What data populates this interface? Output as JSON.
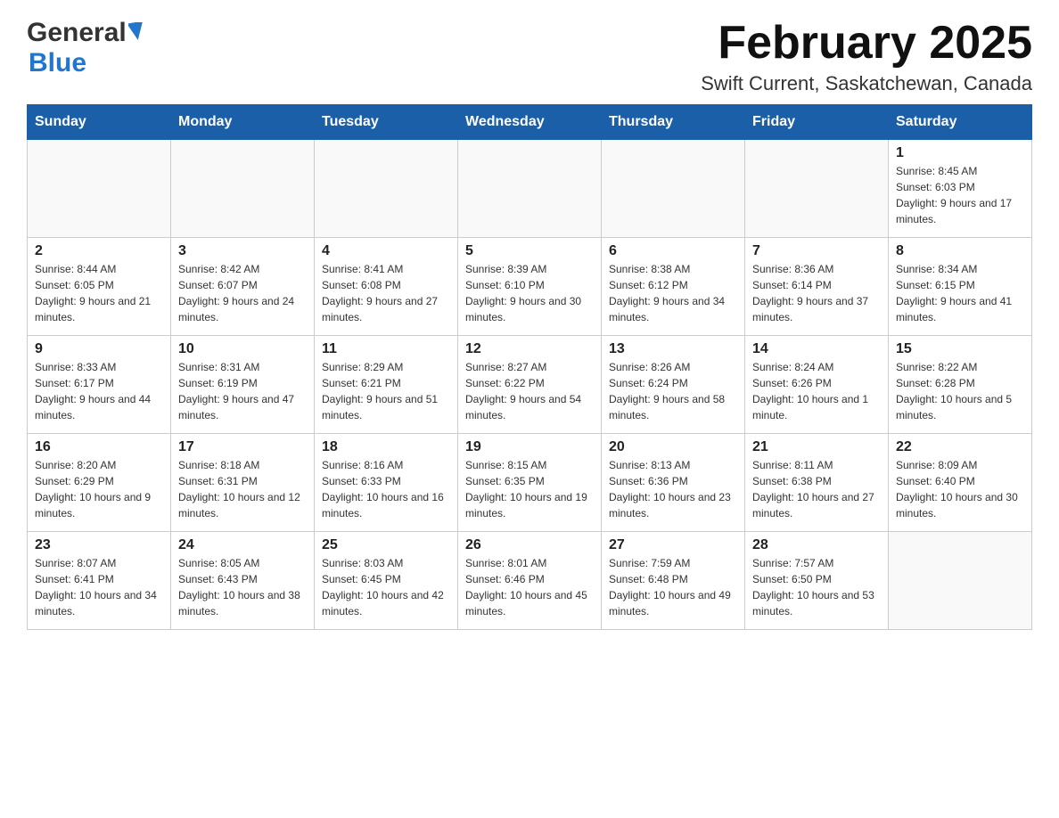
{
  "header": {
    "logo_general": "General",
    "logo_blue": "Blue",
    "title": "February 2025",
    "subtitle": "Swift Current, Saskatchewan, Canada"
  },
  "weekdays": [
    "Sunday",
    "Monday",
    "Tuesday",
    "Wednesday",
    "Thursday",
    "Friday",
    "Saturday"
  ],
  "weeks": [
    [
      {
        "day": "",
        "info": ""
      },
      {
        "day": "",
        "info": ""
      },
      {
        "day": "",
        "info": ""
      },
      {
        "day": "",
        "info": ""
      },
      {
        "day": "",
        "info": ""
      },
      {
        "day": "",
        "info": ""
      },
      {
        "day": "1",
        "info": "Sunrise: 8:45 AM\nSunset: 6:03 PM\nDaylight: 9 hours and 17 minutes."
      }
    ],
    [
      {
        "day": "2",
        "info": "Sunrise: 8:44 AM\nSunset: 6:05 PM\nDaylight: 9 hours and 21 minutes."
      },
      {
        "day": "3",
        "info": "Sunrise: 8:42 AM\nSunset: 6:07 PM\nDaylight: 9 hours and 24 minutes."
      },
      {
        "day": "4",
        "info": "Sunrise: 8:41 AM\nSunset: 6:08 PM\nDaylight: 9 hours and 27 minutes."
      },
      {
        "day": "5",
        "info": "Sunrise: 8:39 AM\nSunset: 6:10 PM\nDaylight: 9 hours and 30 minutes."
      },
      {
        "day": "6",
        "info": "Sunrise: 8:38 AM\nSunset: 6:12 PM\nDaylight: 9 hours and 34 minutes."
      },
      {
        "day": "7",
        "info": "Sunrise: 8:36 AM\nSunset: 6:14 PM\nDaylight: 9 hours and 37 minutes."
      },
      {
        "day": "8",
        "info": "Sunrise: 8:34 AM\nSunset: 6:15 PM\nDaylight: 9 hours and 41 minutes."
      }
    ],
    [
      {
        "day": "9",
        "info": "Sunrise: 8:33 AM\nSunset: 6:17 PM\nDaylight: 9 hours and 44 minutes."
      },
      {
        "day": "10",
        "info": "Sunrise: 8:31 AM\nSunset: 6:19 PM\nDaylight: 9 hours and 47 minutes."
      },
      {
        "day": "11",
        "info": "Sunrise: 8:29 AM\nSunset: 6:21 PM\nDaylight: 9 hours and 51 minutes."
      },
      {
        "day": "12",
        "info": "Sunrise: 8:27 AM\nSunset: 6:22 PM\nDaylight: 9 hours and 54 minutes."
      },
      {
        "day": "13",
        "info": "Sunrise: 8:26 AM\nSunset: 6:24 PM\nDaylight: 9 hours and 58 minutes."
      },
      {
        "day": "14",
        "info": "Sunrise: 8:24 AM\nSunset: 6:26 PM\nDaylight: 10 hours and 1 minute."
      },
      {
        "day": "15",
        "info": "Sunrise: 8:22 AM\nSunset: 6:28 PM\nDaylight: 10 hours and 5 minutes."
      }
    ],
    [
      {
        "day": "16",
        "info": "Sunrise: 8:20 AM\nSunset: 6:29 PM\nDaylight: 10 hours and 9 minutes."
      },
      {
        "day": "17",
        "info": "Sunrise: 8:18 AM\nSunset: 6:31 PM\nDaylight: 10 hours and 12 minutes."
      },
      {
        "day": "18",
        "info": "Sunrise: 8:16 AM\nSunset: 6:33 PM\nDaylight: 10 hours and 16 minutes."
      },
      {
        "day": "19",
        "info": "Sunrise: 8:15 AM\nSunset: 6:35 PM\nDaylight: 10 hours and 19 minutes."
      },
      {
        "day": "20",
        "info": "Sunrise: 8:13 AM\nSunset: 6:36 PM\nDaylight: 10 hours and 23 minutes."
      },
      {
        "day": "21",
        "info": "Sunrise: 8:11 AM\nSunset: 6:38 PM\nDaylight: 10 hours and 27 minutes."
      },
      {
        "day": "22",
        "info": "Sunrise: 8:09 AM\nSunset: 6:40 PM\nDaylight: 10 hours and 30 minutes."
      }
    ],
    [
      {
        "day": "23",
        "info": "Sunrise: 8:07 AM\nSunset: 6:41 PM\nDaylight: 10 hours and 34 minutes."
      },
      {
        "day": "24",
        "info": "Sunrise: 8:05 AM\nSunset: 6:43 PM\nDaylight: 10 hours and 38 minutes."
      },
      {
        "day": "25",
        "info": "Sunrise: 8:03 AM\nSunset: 6:45 PM\nDaylight: 10 hours and 42 minutes."
      },
      {
        "day": "26",
        "info": "Sunrise: 8:01 AM\nSunset: 6:46 PM\nDaylight: 10 hours and 45 minutes."
      },
      {
        "day": "27",
        "info": "Sunrise: 7:59 AM\nSunset: 6:48 PM\nDaylight: 10 hours and 49 minutes."
      },
      {
        "day": "28",
        "info": "Sunrise: 7:57 AM\nSunset: 6:50 PM\nDaylight: 10 hours and 53 minutes."
      },
      {
        "day": "",
        "info": ""
      }
    ]
  ]
}
